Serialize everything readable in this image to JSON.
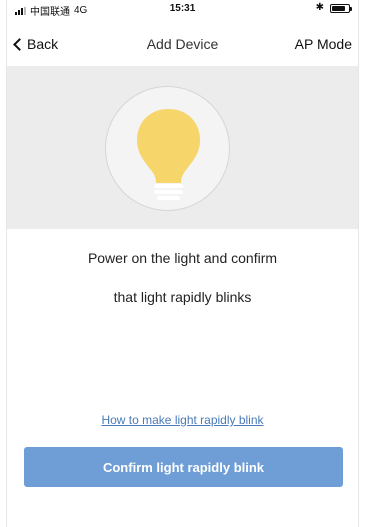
{
  "status_bar": {
    "carrier": "中国联通",
    "network": "4G",
    "time": "15:31",
    "battery_level": 0.8,
    "icons": [
      "signal-icon",
      "bluetooth-icon",
      "battery-icon"
    ]
  },
  "nav": {
    "back_label": "Back",
    "title": "Add Device",
    "right_label": "AP Mode"
  },
  "hero": {
    "icon": "light-bulb-icon",
    "bulb_color": "#f6d66b",
    "background": "#ececec"
  },
  "instructions": {
    "line1": "Power on the light and confirm",
    "line2": "that light rapidly blinks"
  },
  "help_link": "How to make light rapidly blink",
  "confirm_button": {
    "label": "Confirm light rapidly blink",
    "color": "#6f9ed6"
  }
}
